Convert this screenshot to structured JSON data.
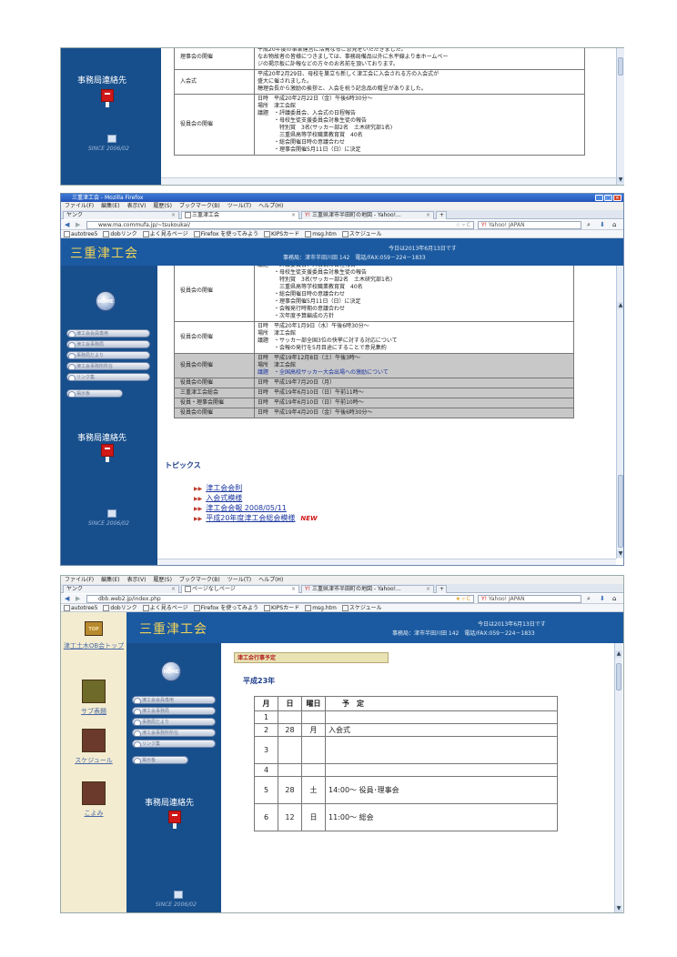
{
  "panel1": {
    "rows": [
      {
        "label": "理事会の開催",
        "lines": [
          "平成20年度の事業運営に活発なるご意見をいただきました。",
          "なお物故者の皆様につきましては、事務局備品以外に水平線より本ホームペー",
          "ジの掲示板に訃報などの方々のお名前を頂いております。"
        ]
      },
      {
        "label": "入会式",
        "lines": [
          "平成20年2月29日、母校を巣立ち新しく津工会に入会される方の入会式が",
          "盛大に催されました。",
          "穂理会長から激励の挨拶と、入会を祝う記念品の贈呈がありました。"
        ]
      },
      {
        "label": "役員会の開催",
        "lines": [
          "日時　平成20年2月22日（金）午後6時30分〜",
          "場所　津工会館",
          "議題　・評議委員会、入会式の日程報告",
          "　　　・母校生徒支援委員会対象生徒の報告",
          "　　　　特別賞　3名(サッカー部2名　土木研究部1名)",
          "　　　　三重県高等学校職業教育賞　40名",
          "　　　・総会開催日時の意議合わせ",
          "　　　・理事会開催5月11日（日）に決定"
        ]
      }
    ],
    "mail_label": "事務局連絡先",
    "since_label": "SINCE 2006/02"
  },
  "panel2": {
    "titlebar": "三重津工会 - Mozilla Firefox",
    "menu": [
      "ファイル(F)",
      "編集(E)",
      "表示(V)",
      "履歴(S)",
      "ブックマーク(B)",
      "ツール(T)",
      "ヘルプ(H)"
    ],
    "tabs": [
      {
        "label": "ヤンク"
      },
      {
        "label": "三重津工会"
      },
      {
        "label": "三重県津市半田町の地図 - Yahoo!..."
      }
    ],
    "url": "www.ma.commufa.jp/~tsukoukai/",
    "search": "Yahoo! JAPAN",
    "bookmarks": [
      "autotree5",
      "dobリンク",
      "よく見るページ",
      "Firefox を使ってみよう",
      "KIPSカード",
      "msg.htm",
      "スケジュール"
    ],
    "site_title": "三重津工会",
    "today": "今日は2013年6月13日です",
    "office": "事務局：津市半田川田 142　電話/FAX:059－224－1833",
    "home_label": "HOME",
    "nav_buttons": [
      "津工会会員専用",
      "津工会事務局",
      "事務局だより",
      "津工会事務所所在",
      "リンク集",
      "掲示板"
    ],
    "mail_label": "事務局連絡先",
    "since_label": "SINCE 2006/02",
    "rows_top": [
      {
        "label": "役員会の開催",
        "lines": [
          "議題　・評議委員会、入会式の日程報告",
          "　　　・母校生徒支援委員会対象生徒の報告",
          "　　　　特別賞　3名(サッカー部2名　土木研究部1名)",
          "　　　　三重県高等学校職業教育賞　40名",
          "　　　・総会開催日時の意議合わせ",
          "　　　・理事会開催5月11日（日）に決定",
          "　　　・会報発行時期の意議合わせ",
          "　　　・次年度予算編成の方針"
        ]
      },
      {
        "label": "役員会の開催",
        "lines": [
          "日時　平成20年1月9日（水）午後6時30分〜",
          "場所　津工会館",
          "議題　・サッカー部全国3位の快挙に対する対応について",
          "　　　・会報の発行を5月目途にすることで意見集約"
        ]
      }
    ],
    "rows_grey": {
      "label": "役員会の開催",
      "lines": [
        "日時　平成19年12月8日（土）午後3時〜",
        "場所　津工会館",
        "議題　・全国高校サッカー大会出場への激励について"
      ]
    },
    "rows_small": [
      {
        "label": "役員会の開催",
        "text": "日時　平成19年7月20日（月）"
      },
      {
        "label": "三重津工会総会",
        "text": "日時　平成19年6月10日（日）午前11時〜"
      },
      {
        "label": "役員・理事会開催",
        "text": "日時　平成19年6月10日（日）午前10時〜"
      },
      {
        "label": "役員会の開催",
        "text": "日時　平成19年4月20日（金）午後6時30分〜"
      }
    ],
    "topics_heading": "トピックス",
    "topics": [
      "津工会会則",
      "入会式模様",
      "津工会会報 2008/05/11",
      "平成20年度津工会総会模様"
    ],
    "new_badge": "NEW"
  },
  "panel3": {
    "menu": [
      "ファイル(F)",
      "編集(E)",
      "表示(V)",
      "履歴(S)",
      "ブックマーク(B)",
      "ツール(T)",
      "ヘルプ(H)"
    ],
    "tabs": [
      {
        "label": "ヤンク"
      },
      {
        "label": "ページなしページ"
      },
      {
        "label": "三重県津市半田町の地図 - Yahoo!..."
      }
    ],
    "url": "dbb.web2.jp/index.php",
    "search": "Yahoo! JAPAN",
    "bookmarks": [
      "autotree5",
      "dobリンク",
      "よく見るページ",
      "Firefox を使ってみよう",
      "KIPSカード",
      "msg.htm",
      "スケジュール"
    ],
    "site_title": "三重津工会",
    "today": "今日は2013年6月13日です",
    "office": "事務局：津市半田川田 142　電話/FAX:059－224－1833",
    "left_links": [
      {
        "icon": "TOP",
        "label": "津工土木OB会トップ"
      },
      {
        "icon": "",
        "label": "サブ表題"
      },
      {
        "icon": "",
        "label": "スケジュール"
      },
      {
        "icon": "",
        "label": "こよみ"
      }
    ],
    "home_label": "HOME",
    "nav_buttons": [
      "津工会会員専用",
      "津工会事務局",
      "事務局だより",
      "津工会事務所所在",
      "リンク集",
      "掲示板"
    ],
    "mail_label": "事務局連絡先",
    "since_label": "SINCE 2006/02",
    "section_banner": "津工会行事予定",
    "year_heading": "平成23年",
    "table_headers": [
      "月",
      "日",
      "曜日",
      "予　定"
    ],
    "schedule": [
      {
        "month": "1",
        "day": "",
        "weekday": "",
        "plan": ""
      },
      {
        "month": "2",
        "day": "28",
        "weekday": "月",
        "plan": "入会式"
      },
      {
        "month": "3",
        "day": "",
        "weekday": "",
        "plan": ""
      },
      {
        "month": "4",
        "day": "",
        "weekday": "",
        "plan": ""
      },
      {
        "month": "5",
        "day": "28",
        "weekday": "土",
        "plan": "14:00〜 役員･理事会"
      },
      {
        "month": "6",
        "day": "12",
        "weekday": "日",
        "plan": "11:00〜 総会"
      }
    ]
  }
}
